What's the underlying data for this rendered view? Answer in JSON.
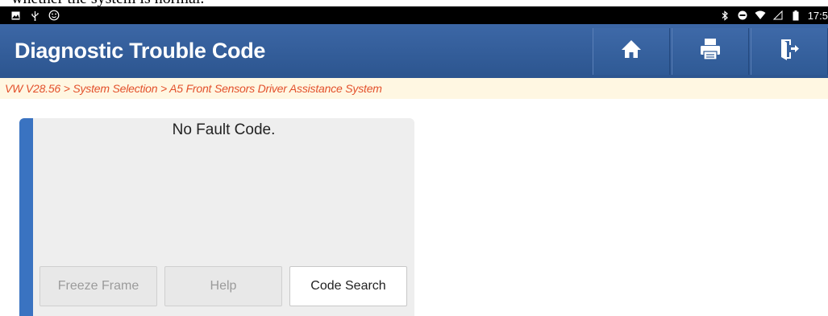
{
  "caption": "whether the system is normal.",
  "status_bar": {
    "left_icons": [
      "gallery-icon",
      "usb-icon",
      "face-icon"
    ],
    "right_icons": [
      "bluetooth-icon",
      "do-not-disturb-icon",
      "wifi-icon",
      "signal-icon",
      "battery-icon"
    ],
    "time": "17:5"
  },
  "header": {
    "title": "Diagnostic Trouble Code",
    "buttons": [
      {
        "name": "home-button",
        "icon": "home-icon"
      },
      {
        "name": "print-button",
        "icon": "printer-icon"
      },
      {
        "name": "exit-button",
        "icon": "exit-door-icon"
      }
    ],
    "color": "#34609c"
  },
  "breadcrumb": {
    "text": "VW V28.56 > System Selection > A5 Front Sensors Driver Assistance System",
    "color": "#e3502b"
  },
  "panel": {
    "message": "No Fault Code.",
    "accent_color": "#3a73c1",
    "buttons": [
      {
        "label": "Freeze Frame",
        "enabled": false
      },
      {
        "label": "Help",
        "enabled": false
      },
      {
        "label": "Code Search",
        "enabled": true
      }
    ]
  }
}
